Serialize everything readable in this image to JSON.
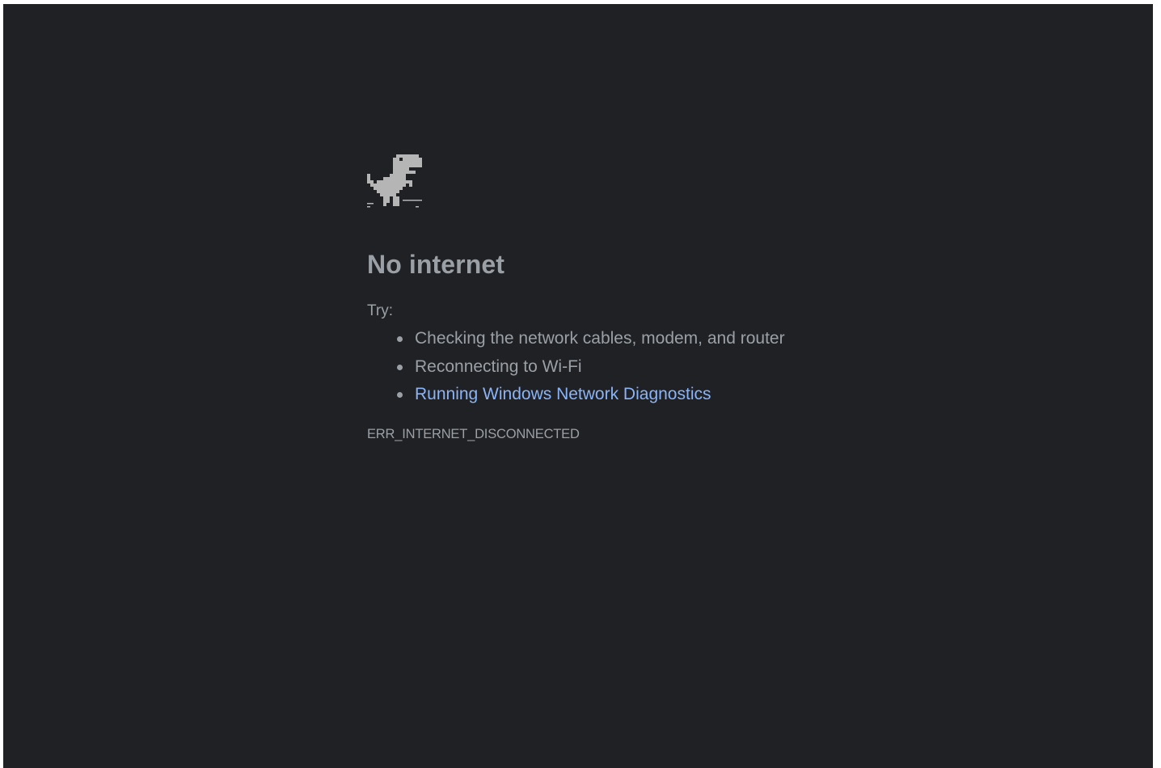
{
  "icons": {
    "dino": "offline-dino-icon"
  },
  "title": "No internet",
  "try_label": "Try:",
  "suggestions": [
    {
      "text": "Checking the network cables, modem, and router",
      "link": false
    },
    {
      "text": "Reconnecting to Wi-Fi",
      "link": false
    },
    {
      "text": "Running Windows Network Diagnostics",
      "link": true
    }
  ],
  "error_code": "ERR_INTERNET_DISCONNECTED",
  "colors": {
    "background": "#202124",
    "text": "#9aa0a6",
    "link": "#8ab4f8",
    "dino": "#b5b5b5"
  }
}
